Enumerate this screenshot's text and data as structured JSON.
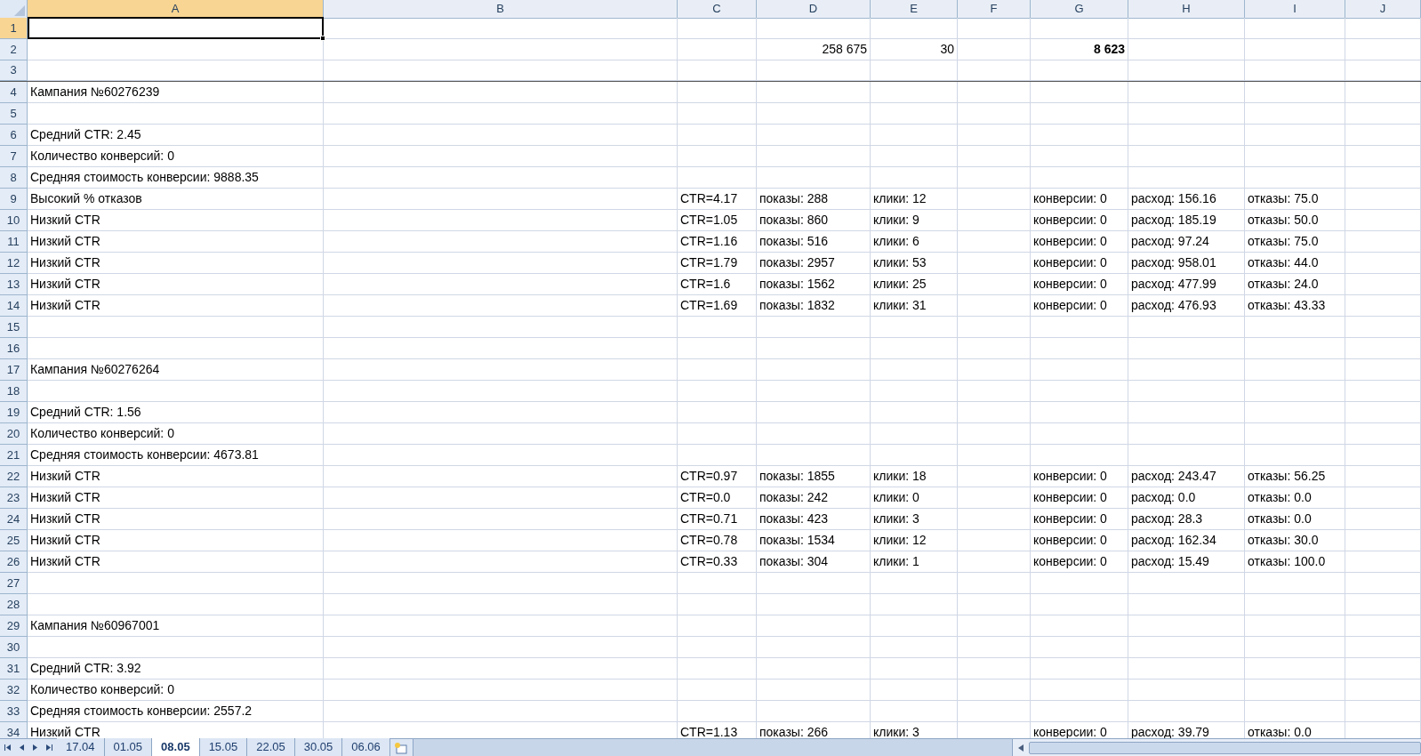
{
  "columns": [
    {
      "label": "A",
      "selected": true
    },
    {
      "label": "B",
      "selected": false
    },
    {
      "label": "C",
      "selected": false
    },
    {
      "label": "D",
      "selected": false
    },
    {
      "label": "E",
      "selected": false
    },
    {
      "label": "F",
      "selected": false
    },
    {
      "label": "G",
      "selected": false
    },
    {
      "label": "H",
      "selected": false
    },
    {
      "label": "I",
      "selected": false
    },
    {
      "label": "J",
      "selected": false
    }
  ],
  "rows": [
    {
      "number": "1",
      "selected": true
    },
    {
      "number": "2",
      "selected": false,
      "cells": [
        null,
        null,
        null,
        {
          "text": "258 675",
          "kind": "number",
          "bold": false
        },
        {
          "text": "30",
          "kind": "number",
          "bold": false
        },
        null,
        {
          "text": "8 623",
          "kind": "number",
          "bold": true
        }
      ]
    },
    {
      "number": "3",
      "selected": false
    },
    {
      "number": "4",
      "selected": false,
      "cells": [
        {
          "text": "Кампания №60276239",
          "kind": "text",
          "bold": false
        }
      ]
    },
    {
      "number": "5",
      "selected": false
    },
    {
      "number": "6",
      "selected": false,
      "cells": [
        {
          "text": "Средний CTR: 2.45",
          "kind": "text",
          "bold": false
        }
      ]
    },
    {
      "number": "7",
      "selected": false,
      "cells": [
        {
          "text": "Количество конверсий: 0",
          "kind": "text",
          "bold": false
        }
      ]
    },
    {
      "number": "8",
      "selected": false,
      "cells": [
        {
          "text": "Средняя стоимость конверсии: 9888.35",
          "kind": "text",
          "bold": false
        }
      ]
    },
    {
      "number": "9",
      "selected": false,
      "cells": [
        {
          "text": "Высокий % отказов",
          "kind": "text",
          "bold": false
        },
        null,
        {
          "text": "CTR=4.17",
          "kind": "text",
          "bold": false
        },
        {
          "text": "показы: 288",
          "kind": "text",
          "bold": false
        },
        {
          "text": "клики: 12",
          "kind": "text",
          "bold": false
        },
        null,
        {
          "text": "конверсии: 0",
          "kind": "text",
          "bold": false
        },
        {
          "text": "расход: 156.16",
          "kind": "text",
          "bold": false
        },
        {
          "text": "отказы: 75.0",
          "kind": "text",
          "bold": false
        }
      ]
    },
    {
      "number": "10",
      "selected": false,
      "cells": [
        {
          "text": "Низкий CTR",
          "kind": "text",
          "bold": false
        },
        null,
        {
          "text": "CTR=1.05",
          "kind": "text",
          "bold": false
        },
        {
          "text": "показы: 860",
          "kind": "text",
          "bold": false
        },
        {
          "text": "клики: 9",
          "kind": "text",
          "bold": false
        },
        null,
        {
          "text": "конверсии: 0",
          "kind": "text",
          "bold": false
        },
        {
          "text": "расход: 185.19",
          "kind": "text",
          "bold": false
        },
        {
          "text": "отказы: 50.0",
          "kind": "text",
          "bold": false
        }
      ]
    },
    {
      "number": "11",
      "selected": false,
      "cells": [
        {
          "text": "Низкий CTR",
          "kind": "text",
          "bold": false
        },
        null,
        {
          "text": "CTR=1.16",
          "kind": "text",
          "bold": false
        },
        {
          "text": "показы: 516",
          "kind": "text",
          "bold": false
        },
        {
          "text": "клики: 6",
          "kind": "text",
          "bold": false
        },
        null,
        {
          "text": "конверсии: 0",
          "kind": "text",
          "bold": false
        },
        {
          "text": "расход: 97.24",
          "kind": "text",
          "bold": false
        },
        {
          "text": "отказы: 75.0",
          "kind": "text",
          "bold": false
        }
      ]
    },
    {
      "number": "12",
      "selected": false,
      "cells": [
        {
          "text": "Низкий CTR",
          "kind": "text",
          "bold": false
        },
        null,
        {
          "text": "CTR=1.79",
          "kind": "text",
          "bold": false
        },
        {
          "text": "показы: 2957",
          "kind": "text",
          "bold": false
        },
        {
          "text": "клики: 53",
          "kind": "text",
          "bold": false
        },
        null,
        {
          "text": "конверсии: 0",
          "kind": "text",
          "bold": false
        },
        {
          "text": "расход: 958.01",
          "kind": "text",
          "bold": false
        },
        {
          "text": "отказы: 44.0",
          "kind": "text",
          "bold": false
        }
      ]
    },
    {
      "number": "13",
      "selected": false,
      "cells": [
        {
          "text": "Низкий CTR",
          "kind": "text",
          "bold": false
        },
        null,
        {
          "text": "CTR=1.6",
          "kind": "text",
          "bold": false
        },
        {
          "text": "показы: 1562",
          "kind": "text",
          "bold": false
        },
        {
          "text": "клики: 25",
          "kind": "text",
          "bold": false
        },
        null,
        {
          "text": "конверсии: 0",
          "kind": "text",
          "bold": false
        },
        {
          "text": "расход: 477.99",
          "kind": "text",
          "bold": false
        },
        {
          "text": "отказы: 24.0",
          "kind": "text",
          "bold": false
        }
      ]
    },
    {
      "number": "14",
      "selected": false,
      "cells": [
        {
          "text": "Низкий CTR",
          "kind": "text",
          "bold": false
        },
        null,
        {
          "text": "CTR=1.69",
          "kind": "text",
          "bold": false
        },
        {
          "text": "показы: 1832",
          "kind": "text",
          "bold": false
        },
        {
          "text": "клики: 31",
          "kind": "text",
          "bold": false
        },
        null,
        {
          "text": "конверсии: 0",
          "kind": "text",
          "bold": false
        },
        {
          "text": "расход: 476.93",
          "kind": "text",
          "bold": false
        },
        {
          "text": "отказы: 43.33",
          "kind": "text",
          "bold": false
        }
      ]
    },
    {
      "number": "15",
      "selected": false
    },
    {
      "number": "16",
      "selected": false
    },
    {
      "number": "17",
      "selected": false,
      "cells": [
        {
          "text": "Кампания №60276264",
          "kind": "text",
          "bold": false
        }
      ]
    },
    {
      "number": "18",
      "selected": false
    },
    {
      "number": "19",
      "selected": false,
      "cells": [
        {
          "text": "Средний CTR: 1.56",
          "kind": "text",
          "bold": false
        }
      ]
    },
    {
      "number": "20",
      "selected": false,
      "cells": [
        {
          "text": "Количество конверсий: 0",
          "kind": "text",
          "bold": false
        }
      ]
    },
    {
      "number": "21",
      "selected": false,
      "cells": [
        {
          "text": "Средняя стоимость конверсии: 4673.81",
          "kind": "text",
          "bold": false
        }
      ]
    },
    {
      "number": "22",
      "selected": false,
      "cells": [
        {
          "text": "Низкий CTR",
          "kind": "text",
          "bold": false
        },
        null,
        {
          "text": "CTR=0.97",
          "kind": "text",
          "bold": false
        },
        {
          "text": "показы: 1855",
          "kind": "text",
          "bold": false
        },
        {
          "text": "клики: 18",
          "kind": "text",
          "bold": false
        },
        null,
        {
          "text": "конверсии: 0",
          "kind": "text",
          "bold": false
        },
        {
          "text": "расход: 243.47",
          "kind": "text",
          "bold": false
        },
        {
          "text": "отказы: 56.25",
          "kind": "text",
          "bold": false
        }
      ]
    },
    {
      "number": "23",
      "selected": false,
      "cells": [
        {
          "text": "Низкий CTR",
          "kind": "text",
          "bold": false
        },
        null,
        {
          "text": "CTR=0.0",
          "kind": "text",
          "bold": false
        },
        {
          "text": "показы: 242",
          "kind": "text",
          "bold": false
        },
        {
          "text": "клики: 0",
          "kind": "text",
          "bold": false
        },
        null,
        {
          "text": "конверсии: 0",
          "kind": "text",
          "bold": false
        },
        {
          "text": "расход: 0.0",
          "kind": "text",
          "bold": false
        },
        {
          "text": "отказы: 0.0",
          "kind": "text",
          "bold": false
        }
      ]
    },
    {
      "number": "24",
      "selected": false,
      "cells": [
        {
          "text": "Низкий CTR",
          "kind": "text",
          "bold": false
        },
        null,
        {
          "text": "CTR=0.71",
          "kind": "text",
          "bold": false
        },
        {
          "text": "показы: 423",
          "kind": "text",
          "bold": false
        },
        {
          "text": "клики: 3",
          "kind": "text",
          "bold": false
        },
        null,
        {
          "text": "конверсии: 0",
          "kind": "text",
          "bold": false
        },
        {
          "text": "расход: 28.3",
          "kind": "text",
          "bold": false
        },
        {
          "text": "отказы: 0.0",
          "kind": "text",
          "bold": false
        }
      ]
    },
    {
      "number": "25",
      "selected": false,
      "cells": [
        {
          "text": "Низкий CTR",
          "kind": "text",
          "bold": false
        },
        null,
        {
          "text": "CTR=0.78",
          "kind": "text",
          "bold": false
        },
        {
          "text": "показы: 1534",
          "kind": "text",
          "bold": false
        },
        {
          "text": "клики: 12",
          "kind": "text",
          "bold": false
        },
        null,
        {
          "text": "конверсии: 0",
          "kind": "text",
          "bold": false
        },
        {
          "text": "расход: 162.34",
          "kind": "text",
          "bold": false
        },
        {
          "text": "отказы: 30.0",
          "kind": "text",
          "bold": false
        }
      ]
    },
    {
      "number": "26",
      "selected": false,
      "cells": [
        {
          "text": "Низкий CTR",
          "kind": "text",
          "bold": false
        },
        null,
        {
          "text": "CTR=0.33",
          "kind": "text",
          "bold": false
        },
        {
          "text": "показы: 304",
          "kind": "text",
          "bold": false
        },
        {
          "text": "клики: 1",
          "kind": "text",
          "bold": false
        },
        null,
        {
          "text": "конверсии: 0",
          "kind": "text",
          "bold": false
        },
        {
          "text": "расход: 15.49",
          "kind": "text",
          "bold": false
        },
        {
          "text": "отказы: 100.0",
          "kind": "text",
          "bold": false
        }
      ]
    },
    {
      "number": "27",
      "selected": false
    },
    {
      "number": "28",
      "selected": false
    },
    {
      "number": "29",
      "selected": false,
      "cells": [
        {
          "text": "Кампания №60967001",
          "kind": "text",
          "bold": false
        }
      ]
    },
    {
      "number": "30",
      "selected": false
    },
    {
      "number": "31",
      "selected": false,
      "cells": [
        {
          "text": "Средний CTR: 3.92",
          "kind": "text",
          "bold": false
        }
      ]
    },
    {
      "number": "32",
      "selected": false,
      "cells": [
        {
          "text": "Количество конверсий: 0",
          "kind": "text",
          "bold": false
        }
      ]
    },
    {
      "number": "33",
      "selected": false,
      "cells": [
        {
          "text": "Средняя стоимость конверсии: 2557.2",
          "kind": "text",
          "bold": false
        }
      ]
    },
    {
      "number": "34",
      "selected": false,
      "cells": [
        {
          "text": "Низкий CTR",
          "kind": "text",
          "bold": false
        },
        null,
        {
          "text": "CTR=1.13",
          "kind": "text",
          "bold": false
        },
        {
          "text": "показы: 266",
          "kind": "text",
          "bold": false
        },
        {
          "text": "клики: 3",
          "kind": "text",
          "bold": false
        },
        null,
        {
          "text": "конверсии: 0",
          "kind": "text",
          "bold": false
        },
        {
          "text": "расход: 39.79",
          "kind": "text",
          "bold": false
        },
        {
          "text": "отказы: 0.0",
          "kind": "text",
          "bold": false
        }
      ]
    }
  ],
  "sheet_tabs": [
    {
      "label": "17.04",
      "selected": false
    },
    {
      "label": "01.05",
      "selected": false
    },
    {
      "label": "08.05",
      "selected": true
    },
    {
      "label": "15.05",
      "selected": false
    },
    {
      "label": "22.05",
      "selected": false
    },
    {
      "label": "30.05",
      "selected": false
    },
    {
      "label": "06.06",
      "selected": false
    }
  ]
}
